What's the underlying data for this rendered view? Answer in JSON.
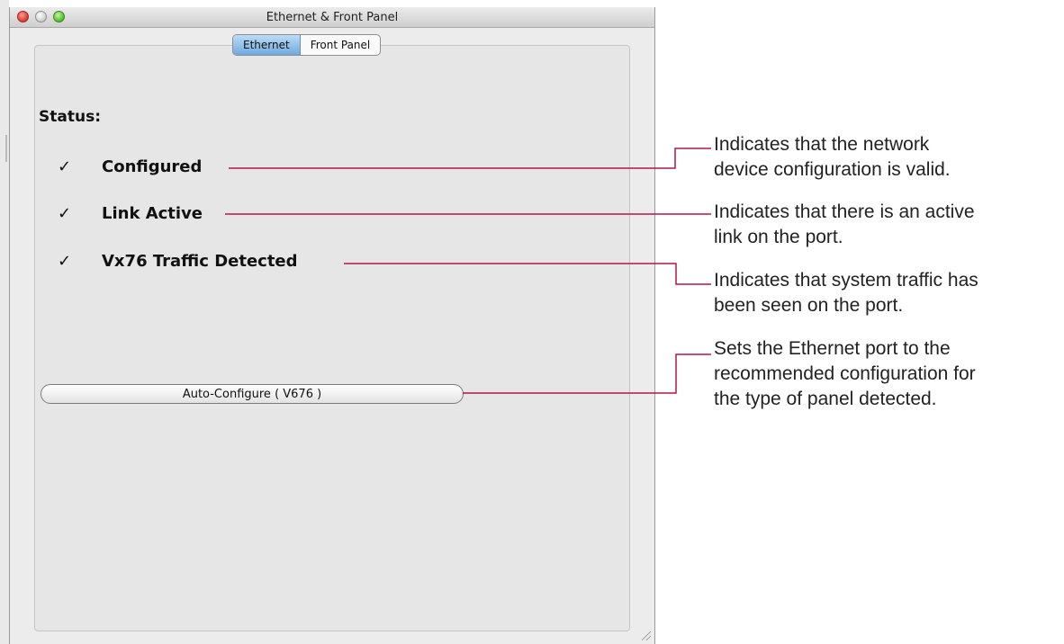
{
  "window": {
    "title": "Ethernet & Front Panel",
    "tabs": [
      {
        "label": "Ethernet",
        "active": true
      },
      {
        "label": "Front Panel",
        "active": false
      }
    ]
  },
  "status": {
    "label": "Status:",
    "items": [
      {
        "check": "✓",
        "label": "Configured"
      },
      {
        "check": "✓",
        "label": "Link Active"
      },
      {
        "check": "✓",
        "label": "Vx76 Traffic Detected"
      }
    ]
  },
  "auto_configure": {
    "label": "Auto-Configure ( V676 )"
  },
  "annotations": [
    {
      "lines": [
        "Indicates that the network",
        "device configuration is valid."
      ]
    },
    {
      "lines": [
        "Indicates that there is an active",
        "link on the port."
      ]
    },
    {
      "lines": [
        "Indicates that system traffic has",
        "been seen on the port."
      ]
    },
    {
      "lines": [
        "Sets the Ethernet port to the",
        "recommended configuration for",
        "the type of panel detected."
      ]
    }
  ],
  "colors": {
    "callout_line": "#b0174a",
    "active_tab": "#7fb3e4"
  }
}
